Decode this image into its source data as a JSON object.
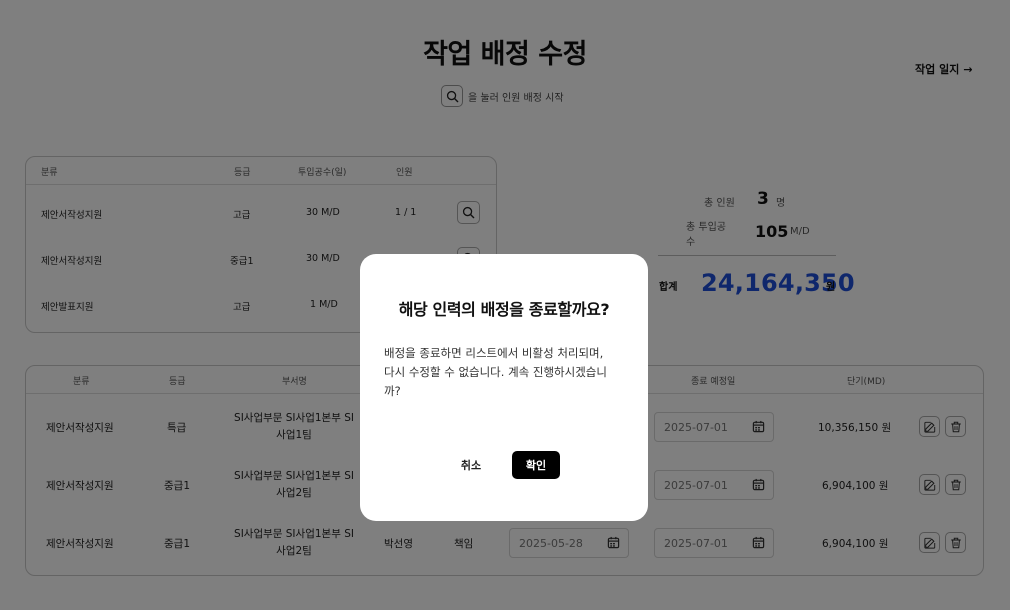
{
  "page": {
    "title": "작업 배정 수정",
    "hint_text": "을 눌러 인원 배정 시작",
    "work_log_label": "작업 일지",
    "work_log_arrow": "→"
  },
  "role_table": {
    "headers": [
      "분류",
      "등급",
      "투입공수(일)",
      "인원"
    ],
    "rows": [
      {
        "category": "제안서작성지원",
        "grade": "고급",
        "effort": "30 M/D",
        "people": "1 / 1"
      },
      {
        "category": "제안서작성지원",
        "grade": "중급1",
        "effort": "30 M/D",
        "people": ""
      },
      {
        "category": "제안발표지원",
        "grade": "고급",
        "effort": "1 M/D",
        "people": ""
      }
    ]
  },
  "summary": {
    "total_people_label": "총 인원",
    "total_people_value": "3",
    "total_people_unit": "명",
    "total_effort_label_line1": "총 투입공",
    "total_effort_label_line2": "수",
    "total_effort_value": "105",
    "total_effort_unit": "M/D",
    "sum_label": "합계",
    "sum_value": "24,164,350",
    "sum_unit": "원"
  },
  "assign_table": {
    "headers": [
      "분류",
      "등급",
      "부서명",
      "종료 예정일",
      "단기(MD)"
    ],
    "rows": [
      {
        "category": "제안서작성지원",
        "grade": "특급",
        "dept_line1": "SI사업부문 SI사업1본부 SI",
        "dept_line2": "사업1팀",
        "name": "",
        "role": "",
        "start_date": "",
        "end_date": "2025-07-01",
        "amount": "10,356,150 원"
      },
      {
        "category": "제안서작성지원",
        "grade": "중급1",
        "dept_line1": "SI사업부문 SI사업1본부 SI",
        "dept_line2": "사업2팀",
        "name": "",
        "role": "",
        "start_date": "",
        "end_date": "2025-07-01",
        "amount": "6,904,100 원"
      },
      {
        "category": "제안서작성지원",
        "grade": "중급1",
        "dept_line1": "SI사업부문 SI사업1본부 SI",
        "dept_line2": "사업2팀",
        "name": "박선영",
        "role": "책임",
        "start_date": "2025-05-28",
        "end_date": "2025-07-01",
        "amount": "6,904,100 원"
      }
    ]
  },
  "modal": {
    "title": "해당 인력의 배정을 종료할까요?",
    "body_line1": "배정을 종료하면 리스트에서 비활성 처리되며,",
    "body_line2": "다시 수정할 수 없습니다. 계속 진행하시겠습니",
    "body_line3": "까?",
    "cancel_label": "취소",
    "confirm_label": "확인"
  },
  "colors": {
    "accent_total": "#1f4fd8",
    "overlay": "rgba(0,0,0,0.5)",
    "confirm_button": "#000000"
  },
  "icons": {
    "search": "search-icon",
    "calendar": "calendar-icon",
    "edit": "edit-icon",
    "delete": "trash-icon"
  }
}
